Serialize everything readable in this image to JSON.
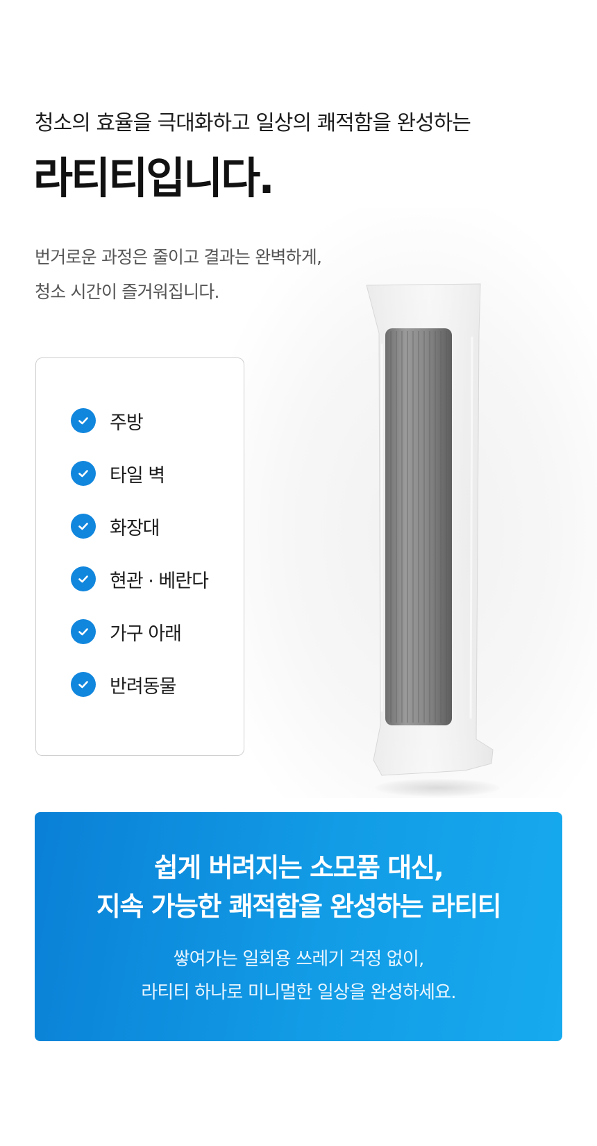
{
  "intro": {
    "subtitle": "청소의 효율을 극대화하고 일상의 쾌적함을 완성하는",
    "headline": "라티티입니다.",
    "description": [
      "번거로운 과정은 줄이고 결과는 완벽하게,",
      "청소 시간이 즐거워집니다."
    ]
  },
  "usage_list": {
    "items": [
      {
        "label": "주방",
        "icon": "check-circle-icon"
      },
      {
        "label": "타일 벽",
        "icon": "check-circle-icon"
      },
      {
        "label": "화장대",
        "icon": "check-circle-icon"
      },
      {
        "label": "현관 · 베란다",
        "icon": "check-circle-icon"
      },
      {
        "label": "가구 아래",
        "icon": "check-circle-icon"
      },
      {
        "label": "반려동물",
        "icon": "check-circle-icon"
      }
    ],
    "check_color": "#1186dd"
  },
  "banner": {
    "headline": [
      "쉽게 버려지는 소모품 대신,",
      "지속 가능한 쾌적함을 완성하는 라티티"
    ],
    "body": [
      "쌓여가는 일회용 쓰레기 걱정 없이,",
      "라티티 하나로 미니멀한 일상을 완성하세요."
    ],
    "gradient_start": "#0a80d6",
    "gradient_end": "#17aaee"
  }
}
